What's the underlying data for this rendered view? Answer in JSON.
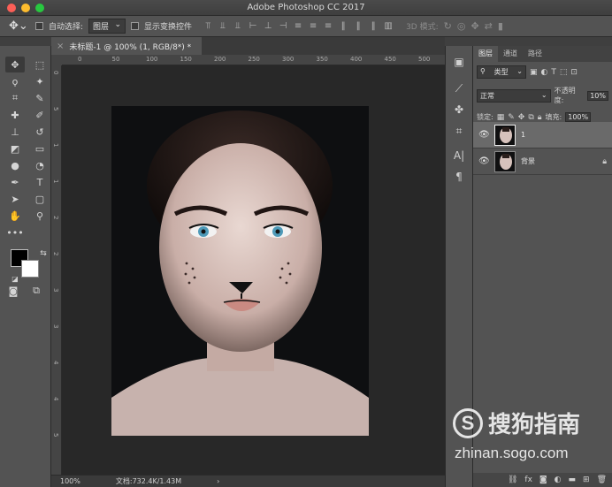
{
  "window": {
    "title": "Adobe Photoshop CC 2017"
  },
  "options": {
    "auto_select_label": "自动选择:",
    "auto_select_value": "图层",
    "show_transform_label": "显示变换控件",
    "mode3d_label": "3D 模式:"
  },
  "document": {
    "tab_label": "未标题-1 @ 100% (1, RGB/8*) *",
    "ruler_ticks": [
      "0",
      "50",
      "100",
      "150",
      "200",
      "250",
      "300",
      "350",
      "400",
      "450",
      "500"
    ],
    "vruler_ticks": [
      "0",
      "5",
      "1",
      "1",
      "2",
      "2",
      "3",
      "3",
      "4",
      "4",
      "5"
    ]
  },
  "status": {
    "zoom": "100%",
    "doc_info": "文档:732.4K/1.43M"
  },
  "layers_panel": {
    "tabs": [
      "图层",
      "通道",
      "路径"
    ],
    "filter_kind": "类型",
    "blend_mode": "正常",
    "opacity_label": "不透明度:",
    "opacity_value": "10%",
    "lock_label": "锁定:",
    "fill_label": "填充:",
    "fill_value": "100%",
    "layers": [
      {
        "name": "1",
        "selected": true
      },
      {
        "name": "背景",
        "selected": false,
        "locked": true
      }
    ],
    "bottom_fx": "fx"
  },
  "watermark": {
    "brand": "搜狗指南",
    "url": "zhinan.sogo.com"
  }
}
